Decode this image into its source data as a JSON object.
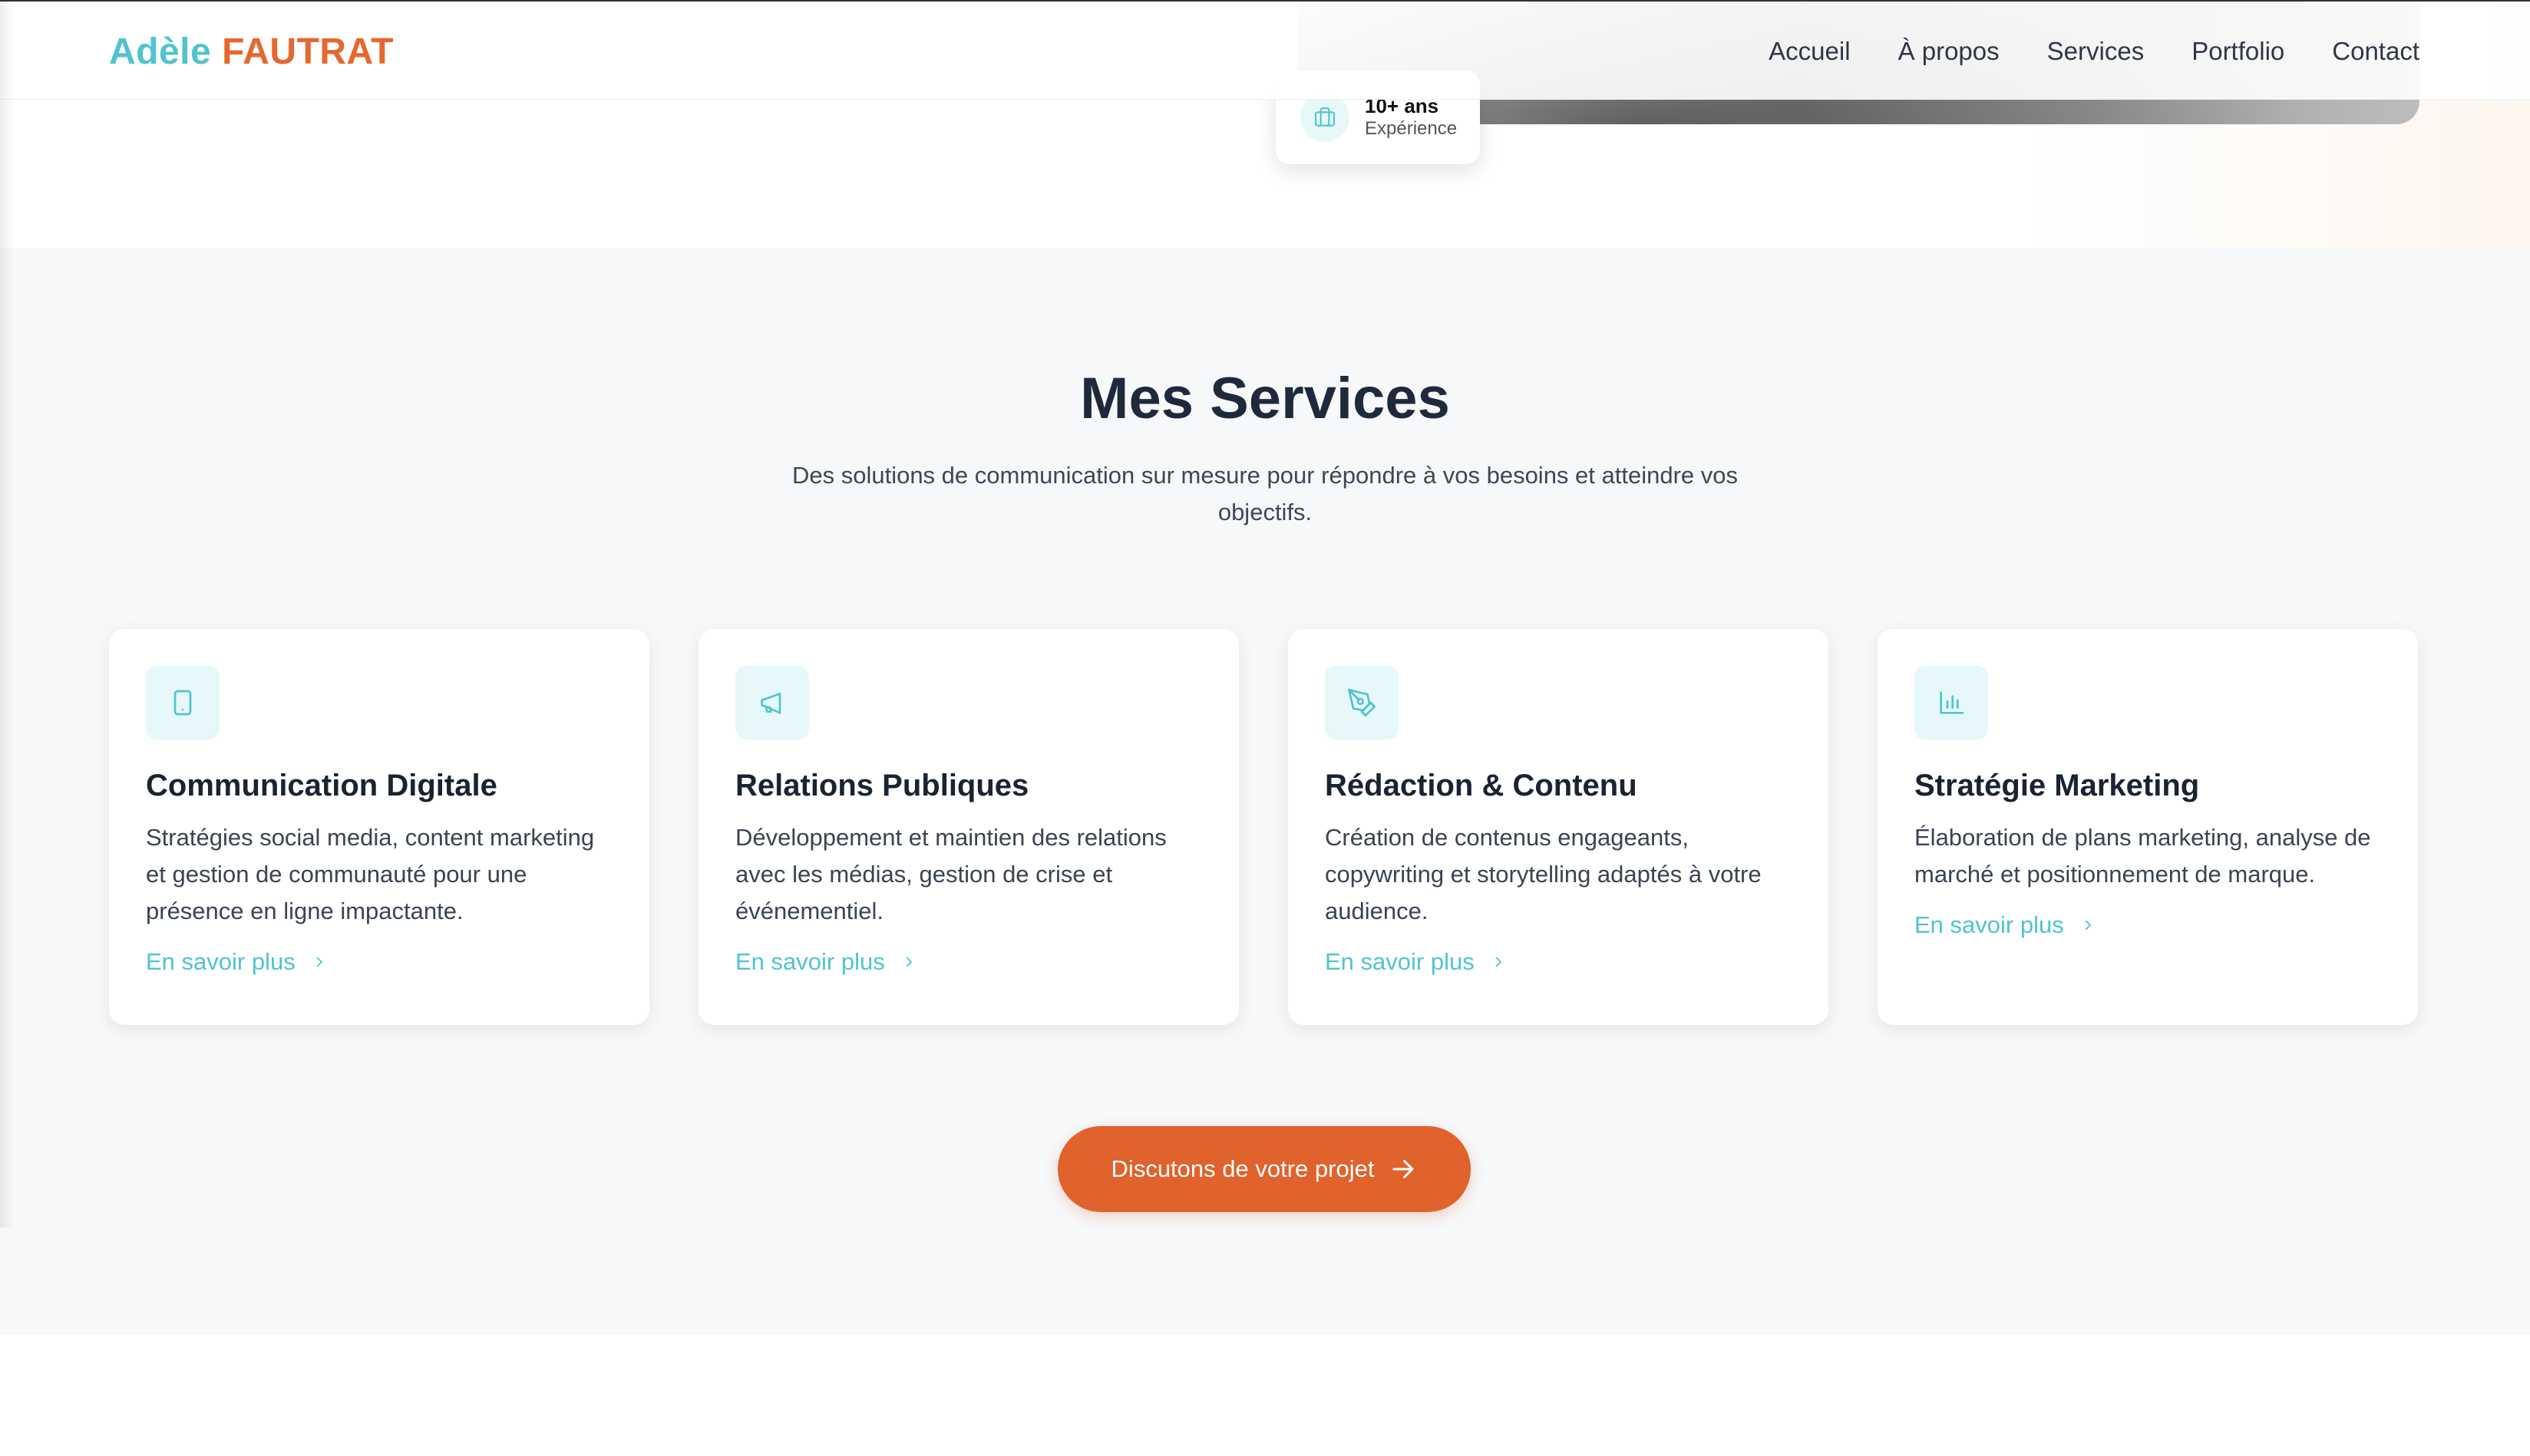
{
  "brand": {
    "first_name": "Adèle",
    "last_name": "FAUTRAT",
    "accent_teal": "#4fc4cf",
    "accent_orange": "#e4682f"
  },
  "nav": {
    "items": [
      {
        "label": "Accueil"
      },
      {
        "label": "À propos"
      },
      {
        "label": "Services"
      },
      {
        "label": "Portfolio"
      },
      {
        "label": "Contact"
      }
    ]
  },
  "hero": {
    "stat": {
      "icon": "briefcase-icon",
      "value": "10+ ans",
      "label": "Expérience"
    }
  },
  "services": {
    "title": "Mes Services",
    "subtitle": "Des solutions de communication sur mesure pour répondre à vos besoins et atteindre vos objectifs.",
    "cards": [
      {
        "icon": "tablet-icon",
        "title": "Communication Digitale",
        "description": "Stratégies social media, content marketing et gestion de communauté pour une présence en ligne impactante.",
        "link": "En savoir plus"
      },
      {
        "icon": "megaphone-icon",
        "title": "Relations Publiques",
        "description": "Développement et maintien des relations avec les médias, gestion de crise et événementiel.",
        "link": "En savoir plus"
      },
      {
        "icon": "pen-nib-icon",
        "title": "Rédaction & Contenu",
        "description": "Création de contenus engageants, copywriting et storytelling adaptés à votre audience.",
        "link": "En savoir plus"
      },
      {
        "icon": "bar-chart-icon",
        "title": "Stratégie Marketing",
        "description": "Élaboration de plans marketing, analyse de marché et positionnement de marque.",
        "link": "En savoir plus"
      }
    ],
    "cta": "Discutons de votre projet"
  }
}
